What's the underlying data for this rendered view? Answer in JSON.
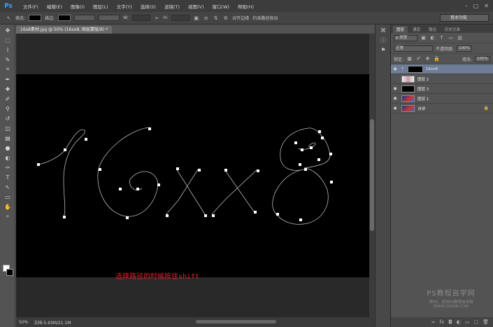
{
  "app": {
    "logo": "Ps"
  },
  "menu": [
    "文件(F)",
    "编辑(E)",
    "图像(I)",
    "图层(L)",
    "文字(Y)",
    "选择(S)",
    "滤镜(T)",
    "视图(V)",
    "窗口(W)",
    "帮助(H)"
  ],
  "window_buttons": [
    "–",
    "□",
    "✕"
  ],
  "options": {
    "fill_label": "填充:",
    "stroke_label": "描边:",
    "w_label": "W:",
    "h_label": "H:",
    "align_edges_label": "对齐边缘",
    "constrain_label": "约束路径拖动",
    "workspace": "基本功能"
  },
  "document": {
    "tab_title": "16x8素材.jpg @ 50% (16xx8, 图层蒙版/8) *",
    "annotation": "选择路径的时候按住shift",
    "zoom": "50%",
    "doc_info": "文档:5.93M/21.1M"
  },
  "layers_panel": {
    "tabs": [
      "图层",
      "通道",
      "路径",
      "历史记录"
    ],
    "active_tab": 0,
    "filter_label": "ρ 类型",
    "blend_mode": "正常",
    "opacity_label": "不透明度:",
    "opacity_value": "100%",
    "lock_label": "锁定:",
    "fill_label": "填充:",
    "fill_value": "100%",
    "layers": [
      {
        "name": "16xx8",
        "type": "text",
        "visible": true,
        "selected": true
      },
      {
        "name": "图层 2",
        "type": "pixel",
        "visible": false,
        "selected": false
      },
      {
        "name": "图层 3",
        "type": "pixel",
        "visible": true,
        "selected": false
      },
      {
        "name": "图层 1",
        "type": "pixel",
        "visible": true,
        "selected": false
      },
      {
        "name": "背景",
        "type": "background",
        "visible": true,
        "selected": false,
        "locked": true
      }
    ]
  },
  "watermark": {
    "title": "PS教程自学网",
    "subtitle": "学PS，就到PS教程自学网",
    "url": "WWW.16XX8.COM"
  },
  "colors": {
    "annotation": "#e8202a",
    "selected_layer": "#6e7d95",
    "canvas": "#000000",
    "path": "#b9b9b9"
  }
}
